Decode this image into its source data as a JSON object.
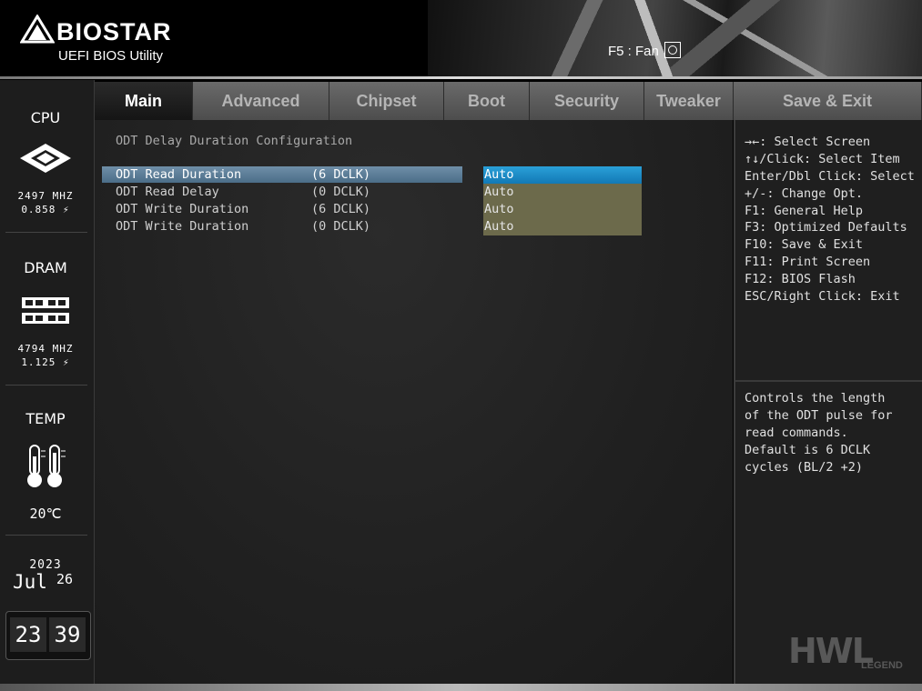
{
  "header": {
    "brand": "BIOSTAR",
    "subtitle": "UEFI BIOS Utility",
    "fan_label": "F5 : Fan"
  },
  "sidebar": {
    "cpu": {
      "title": "CPU",
      "freq": "2497 MHZ",
      "volt": "0.858 ⚡"
    },
    "dram": {
      "title": "DRAM",
      "freq": "4794 MHZ",
      "volt": "1.125 ⚡"
    },
    "temp": {
      "title": "TEMP",
      "value": "20℃"
    },
    "date": {
      "year": "2023",
      "month": "Jul",
      "day": "26"
    },
    "clock": {
      "hours": "23",
      "minutes": "39"
    }
  },
  "tabs": [
    {
      "label": "Main",
      "active": true
    },
    {
      "label": "Advanced"
    },
    {
      "label": "Chipset"
    },
    {
      "label": "Boot"
    },
    {
      "label": "Security"
    },
    {
      "label": "Tweaker"
    },
    {
      "label": "Save & Exit"
    }
  ],
  "main": {
    "section_title": "ODT Delay Duration Configuration",
    "rows": [
      {
        "label": "ODT Read Duration",
        "current": "(6 DCLK)",
        "option": "Auto",
        "selected": true
      },
      {
        "label": "ODT Read Delay",
        "current": "(0 DCLK)",
        "option": "Auto"
      },
      {
        "label": "ODT Write Duration",
        "current": "(6 DCLK)",
        "option": "Auto"
      },
      {
        "label": "ODT Write Duration",
        "current": "(0 DCLK)",
        "option": "Auto"
      }
    ]
  },
  "help": {
    "keys": [
      "→←: Select Screen",
      "↑↓/Click: Select Item",
      "Enter/Dbl Click: Select",
      "+/-: Change Opt.",
      "F1: General Help",
      "F3: Optimized Defaults",
      "F10: Save & Exit",
      "F11: Print Screen",
      "F12: BIOS Flash",
      "ESC/Right Click: Exit"
    ],
    "description": "Controls the length\nof the ODT pulse for\nread commands.\nDefault is 6 DCLK\ncycles (BL/2 +2)"
  },
  "watermark": {
    "main": "HWL",
    "sub": "LEGEND"
  }
}
